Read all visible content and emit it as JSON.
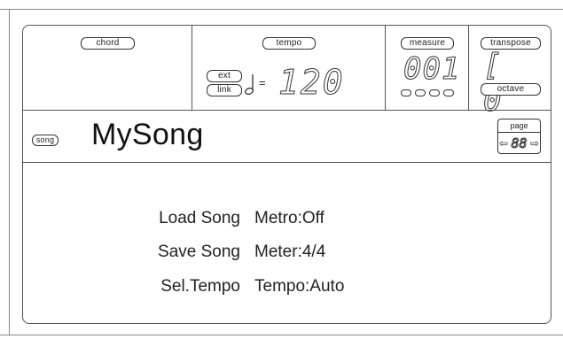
{
  "header": {
    "chord_label": "chord",
    "tempo_label": "tempo",
    "ext_label": "ext",
    "link_label": "link",
    "tempo_value": "120",
    "measure_label": "measure",
    "measure_value": "001",
    "transpose_label": "transpose",
    "transpose_value": "[ 0",
    "octave_label": "octave",
    "beat_indicators": 4,
    "icon_tempo": "quarter-note-icon"
  },
  "title_band": {
    "mode_label": "song",
    "song_name": "MySong",
    "page_label": "page",
    "page_number": "88",
    "page_prev_icon": "arrow-left-icon",
    "page_next_icon": "arrow-right-icon"
  },
  "menu": {
    "left": [
      "Load Song",
      "Save Song",
      "Sel.Tempo"
    ],
    "right": [
      "Metro:Off",
      "Meter:4/4",
      "Tempo:Auto"
    ]
  }
}
